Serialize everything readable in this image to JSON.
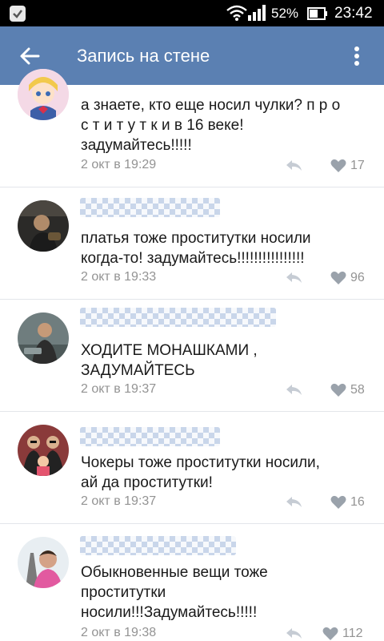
{
  "status_bar": {
    "battery": "52%",
    "time": "23:42",
    "icons": [
      "vk-app-icon",
      "wifi-icon",
      "signal-icon",
      "battery-icon"
    ]
  },
  "app_bar": {
    "title": "Запись на стене",
    "back_icon": "arrow-left-icon",
    "menu_icon": "more-vert-icon",
    "color": "#5b80b2"
  },
  "comments": [
    {
      "text": "а знаете, кто еще носил чулки? п р о\nс т и т у т к и в 16 веке!\nзадумайтесь!!!!!",
      "date": "2 окт в 19:29",
      "likes": "17"
    },
    {
      "text": "платья тоже проститутки носили\nкогда-то! задумайтесь!!!!!!!!!!!!!!!!",
      "date": "2 окт в 19:33",
      "likes": "96"
    },
    {
      "text": "ХОДИТЕ МОНАШКАМИ ,\nЗАДУМАЙТЕСЬ",
      "date": "2 окт в 19:37",
      "likes": "58"
    },
    {
      "text": "Чокеры тоже проститутки носили,\nай да проститутки!",
      "date": "2 окт в 19:37",
      "likes": "16"
    },
    {
      "text": "Обыкновенные вещи тоже\nпроститутки\nносили!!!Задумайтесь!!!!!",
      "date": "2 окт в 19:38",
      "likes": "112"
    }
  ],
  "colors": {
    "secondary_text": "#939393",
    "divider": "#e3e6ea"
  }
}
